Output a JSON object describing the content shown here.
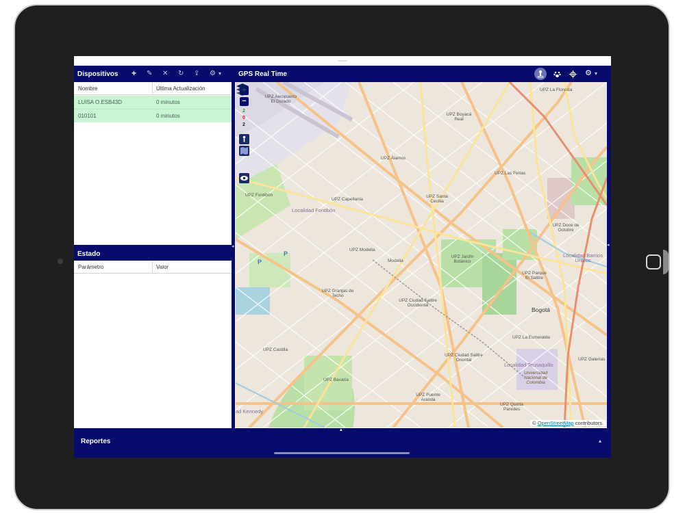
{
  "devices_panel": {
    "title": "Dispositivos",
    "toolbar": {
      "add": "+",
      "edit": "✎",
      "remove": "✕",
      "refresh": "↻",
      "upload": "⇪",
      "settings": "⚙",
      "dropdown": "▾"
    },
    "columns": [
      "Nombre",
      "Última Actualización"
    ],
    "rows": [
      {
        "name": "LUISA O.ESB43D",
        "updated": "0 minutos"
      },
      {
        "name": "010101",
        "updated": "0 minutos"
      }
    ]
  },
  "state_panel": {
    "title": "Estado",
    "columns": [
      "Parámetro",
      "Valor"
    ]
  },
  "map_panel": {
    "title": "GPS Real Time",
    "toolbar_icons": [
      "person-location-icon",
      "paw-icon",
      "crosshair-icon",
      "gear-icon"
    ],
    "zoom_in": "+",
    "zoom_out": "−",
    "counters": [
      "2",
      "0",
      "2"
    ],
    "labels": {
      "airport": "UPZ Aeropuerto El Dorado",
      "boyaca": "UPZ Boyacá Real",
      "alamos": "UPZ Álamos",
      "la_floresta": "UPZ La Floresta",
      "las_ferias": "UPZ Las Ferias",
      "santa_cecilia": "UPZ Santa Cecilia",
      "capellania": "UPZ Capellanía",
      "fontibon": "UPZ Fontibón",
      "loc_fontibon": "Localidad Fontibón",
      "modelia_upz": "UPZ Modelia",
      "modelia": "Modelia",
      "jardin": "UPZ Jardín Botánico",
      "doce_octubre": "UPZ Doce de Octubre",
      "barrios_unidos": "Localidad Barrios Unidos",
      "parque_salitre": "UPZ Parque El Salitre",
      "granjas": "UPZ Granjas de Techo",
      "ciudad_salitre_occ": "UPZ Ciudad Salitre Occidental",
      "bogota": "Bogotá",
      "esmeralda": "UPZ La Esmeralda",
      "castilla": "UPZ Castilla",
      "salitre_oriental": "UPZ Ciudad Salitre Oriental",
      "galerias": "UPZ Galerías",
      "teusaquillo": "Localidad Teusaquillo",
      "universidad": "Universidad Nacional de Colombia",
      "bavaria": "UPZ Bavaria",
      "puente_aranda": "UPZ Puente Aranda",
      "quinta_paredes": "UPZ Quinta Paredes",
      "kennedy": "ad Kennedy",
      "parking_p": "P"
    },
    "attribution_prefix": "© ",
    "attribution_link": "OpenStreetMap",
    "attribution_suffix": " contributors."
  },
  "reportes": {
    "title": "Reportes",
    "collapse_icon": "▴"
  },
  "colors": {
    "header": "#070b6b",
    "row_selected": "#c9f5d5"
  }
}
